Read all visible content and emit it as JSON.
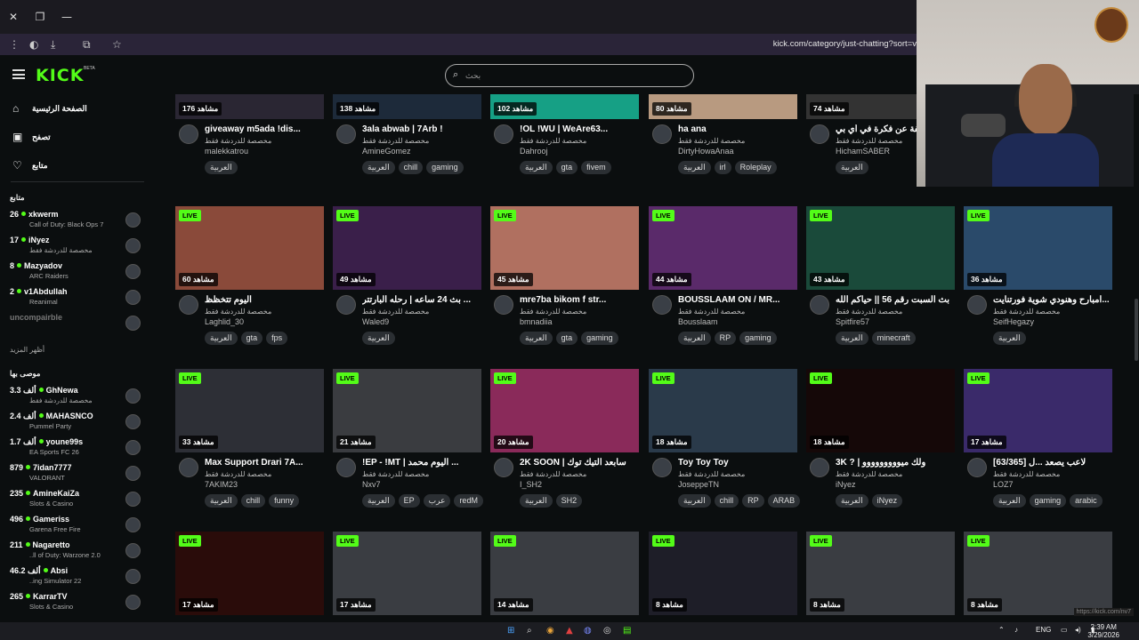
{
  "browser": {
    "url": "kick.com/category/just-chatting?sort=v"
  },
  "kick": {
    "logo": "KICK",
    "beta": "BETA",
    "search_placeholder": "بحث"
  },
  "sidebar": {
    "nav": [
      {
        "label": "الصفحة الرئيسية",
        "icon": "home-icon"
      },
      {
        "label": "تصفح",
        "icon": "browse-icon"
      },
      {
        "label": "متابع",
        "icon": "heart-icon"
      }
    ],
    "following_title": "متابع",
    "following": [
      {
        "name": "xkwerm",
        "viewers": "26",
        "category": "Call of Duty: Black Ops 7"
      },
      {
        "name": "iNyez",
        "viewers": "17",
        "category": "مخصصة للدردشة فقط"
      },
      {
        "name": "Mazyadov",
        "viewers": "8",
        "category": "ARC Raiders"
      },
      {
        "name": "v1Abdullah",
        "viewers": "2",
        "category": "Reanimal"
      },
      {
        "name": "uncompairble",
        "viewers": "",
        "category": ""
      }
    ],
    "show_more": "أظهر المزيد",
    "recommended_title": "موصى بها",
    "recommended": [
      {
        "name": "GhNewa",
        "viewers": "3.3 ألف",
        "category": "مخصصة للدردشة فقط"
      },
      {
        "name": "MAHASNCO",
        "viewers": "2.4 ألف",
        "category": "Pummel Party"
      },
      {
        "name": "youne99s",
        "viewers": "1.7 ألف",
        "category": "EA Sports FC 26"
      },
      {
        "name": "7idan7777",
        "viewers": "879",
        "category": "VALORANT"
      },
      {
        "name": "AmineKaiZa",
        "viewers": "235",
        "category": "Slots & Casino"
      },
      {
        "name": "Gameriss",
        "viewers": "496",
        "category": "Garena Free Fire"
      },
      {
        "name": "Nagaretto",
        "viewers": "211",
        "category": "..ll of Duty: Warzone 2.0"
      },
      {
        "name": "Absi",
        "viewers": "46.2 ألف",
        "category": "..ing Simulator 22"
      },
      {
        "name": "KarrarTV",
        "viewers": "265",
        "category": "Slots & Casino"
      }
    ]
  },
  "grid": {
    "category_label": "مخصصة للدردشة فقط",
    "live_label": "LIVE",
    "rows": [
      [
        {
          "views": "176 مشاهد",
          "live": false,
          "title": "giveaway m5ada !dis...",
          "user": "malekkatrou",
          "tags": [
            "العربية"
          ],
          "color": "#2a2633"
        },
        {
          "views": "138 مشاهد",
          "live": false,
          "title": "3ala abwab | 7Arb !",
          "user": "AmineGomez",
          "tags": [
            "العربية",
            "chill",
            "gaming"
          ],
          "color": "#1d2a3a"
        },
        {
          "views": "102 مشاهد",
          "live": false,
          "title": "!OL !WU | WeAre63...",
          "user": "Dahrooj",
          "tags": [
            "العربية",
            "gta",
            "fivem"
          ],
          "color": "#16a085"
        },
        {
          "views": "80 مشاهد",
          "live": false,
          "title": "ha ana",
          "user": "DirtyHowaAnaa",
          "tags": [
            "العربية",
            "irl",
            "Roleplay"
          ],
          "color": "#b89a80"
        },
        {
          "views": "74 مشاهد",
          "live": false,
          "title": "سالفة عن فكرة في أي بي",
          "user": "HichamSABER",
          "tags": [
            "العربية"
          ],
          "color": "#333"
        }
      ],
      [
        {
          "views": "60 مشاهد",
          "live": true,
          "title": "اليوم تتخظظ",
          "user": "Laghlid_30",
          "tags": [
            "العربية",
            "gta",
            "fps"
          ],
          "color": "#8a4a3a"
        },
        {
          "views": "49 مشاهد",
          "live": true,
          "title": "بث 24 ساعه | رحله البارتتر ...",
          "user": "Waled9",
          "tags": [
            "العربية"
          ],
          "color": "#3a1f4a"
        },
        {
          "views": "45 مشاهد",
          "live": true,
          "title": "mre7ba bikom f str...",
          "user": "bmnadiia",
          "tags": [
            "العربية",
            "gta",
            "gaming"
          ],
          "color": "#b07060"
        },
        {
          "views": "44 مشاهد",
          "live": true,
          "title": "BOUSSLAAM ON / MR...",
          "user": "Bousslaam",
          "tags": [
            "العربية",
            "RP",
            "gaming"
          ],
          "color": "#5a2a6a"
        },
        {
          "views": "43 مشاهد",
          "live": true,
          "title": "بث السبت رقم 56 || حياكم الله",
          "user": "Spitfire57",
          "tags": [
            "العربية",
            "minecraft"
          ],
          "color": "#1a4a3a"
        },
        {
          "views": "36 مشاهد",
          "live": true,
          "title": "امبارح وهنودي شوية فورتنايت...",
          "user": "SeifHegazy",
          "tags": [
            "العربية"
          ],
          "color": "#2a4a6a"
        }
      ],
      [
        {
          "views": "33 مشاهد",
          "live": true,
          "title": "Max Support Drari 7A...",
          "user": "7AKIM23",
          "tags": [
            "العربية",
            "chill",
            "funny"
          ],
          "color": "#2d2f36"
        },
        {
          "views": "21 مشاهد",
          "live": true,
          "title": "!EP - !MT | اليوم محمد ...",
          "user": "Nxv7",
          "tags": [
            "العربية",
            "EP",
            "عرب",
            "redM"
          ],
          "color": "#3a3c40"
        },
        {
          "views": "20 مشاهد",
          "live": true,
          "title": "2K SOON | سابعد التيك توك",
          "user": "I_SH2",
          "tags": [
            "العربية",
            "SH2"
          ],
          "color": "#8a2a5a"
        },
        {
          "views": "18 مشاهد",
          "live": true,
          "title": "Toy Toy Toy",
          "user": "JoseppeTN",
          "tags": [
            "العربية",
            "chill",
            "RP",
            "ARAB"
          ],
          "color": "#2a3a4a"
        },
        {
          "views": "18 مشاهد",
          "live": true,
          "title": "3K ? | ولك ميووووووووو",
          "user": "iNyez",
          "tags": [
            "العربية",
            "iNyez"
          ],
          "color": "#150808"
        },
        {
          "views": "17 مشاهد",
          "live": true,
          "title": "[63/365] لاعب يصعد ...ل",
          "user": "LOZ7",
          "tags": [
            "العربية",
            "gaming",
            "arabic"
          ],
          "color": "#3a2a6a"
        }
      ],
      [
        {
          "views": "17 مشاهد",
          "live": true,
          "color": "#2a0c0a"
        },
        {
          "views": "17 مشاهد",
          "live": true,
          "color": "#3a3d42"
        },
        {
          "views": "14 مشاهد",
          "live": true,
          "color": "#3a3d42"
        },
        {
          "views": "8 مشاهد",
          "live": true,
          "color": "#1e1e28"
        },
        {
          "views": "8 مشاهد",
          "live": true,
          "color": "#3a3d42"
        },
        {
          "views": "8 مشاهد",
          "live": true,
          "color": "#3a3d42"
        }
      ]
    ]
  },
  "status_url": "https://kick.com/nv7",
  "taskbar": {
    "lang": "ENG",
    "time": "2:39 AM",
    "date": "3/29/2026"
  }
}
